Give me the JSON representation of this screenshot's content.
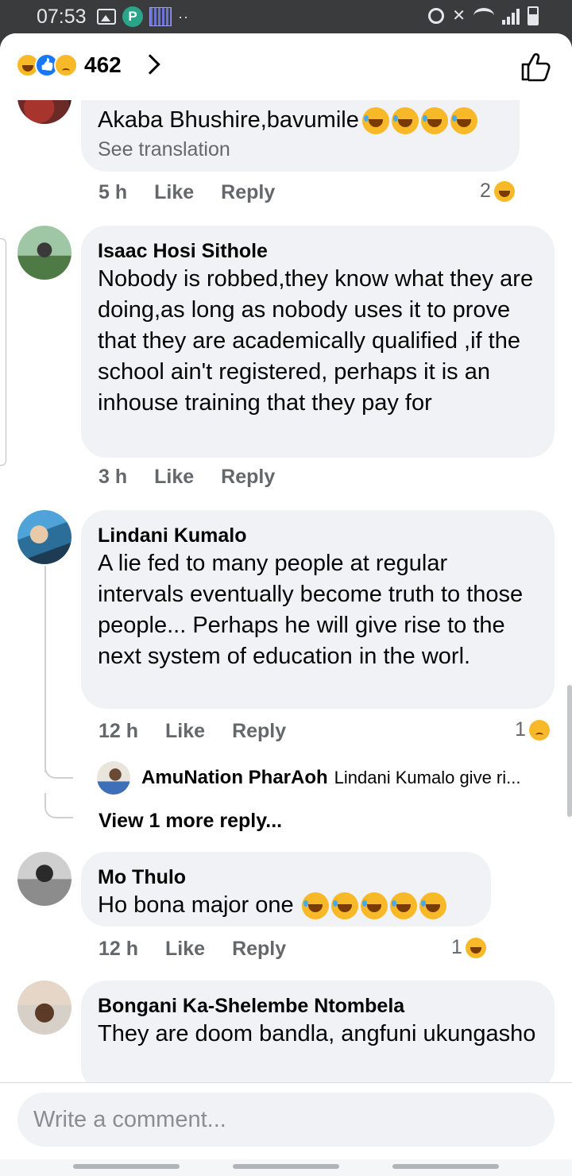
{
  "status_bar": {
    "time": "07:53",
    "dots": "··",
    "sb_p": "P",
    "sb_mute": "✕"
  },
  "header": {
    "reaction_count": "462"
  },
  "comments": [
    {
      "author": "",
      "text": "Akaba Bhushire,bavumile",
      "translate": "See translation",
      "time": "5 h",
      "like": "Like",
      "reply": "Reply",
      "reaction_count": "2"
    },
    {
      "author": "Isaac Hosi Sithole",
      "text": "Nobody is robbed,they know what they are doing,as long as nobody uses it to prove that they are academically qualified ,if the school ain't registered, perhaps it is an inhouse training that they pay for",
      "time": "3 h",
      "like": "Like",
      "reply": "Reply"
    },
    {
      "author": "Lindani Kumalo",
      "text": "A lie fed to many people at regular intervals eventually become truth to those people... Perhaps he will give rise to the next system of education in the worl.",
      "time": "12 h",
      "like": "Like",
      "reply": "Reply",
      "reaction_count": "1",
      "reply_preview": {
        "author": "AmuNation PharAoh",
        "text": "Lindani Kumalo give ri..."
      },
      "view_more": "View 1 more reply..."
    },
    {
      "author": "Mo Thulo",
      "text": "Ho bona major one",
      "time": "12 h",
      "like": "Like",
      "reply": "Reply",
      "reaction_count": "1"
    },
    {
      "author": "Bongani Ka-Shelembe Ntombela",
      "text": "They are doom bandla, angfuni ukungasho"
    }
  ],
  "composer": {
    "placeholder": "Write a comment..."
  },
  "colors": {
    "accent": "#1877f2",
    "bubble": "#f0f2f5",
    "muted": "#65676b",
    "emoji": "#f7b928"
  }
}
